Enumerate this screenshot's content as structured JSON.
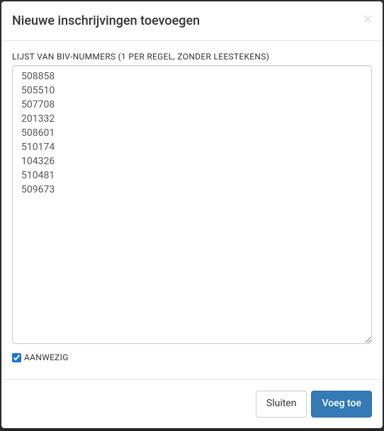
{
  "modal": {
    "title": "Nieuwe inschrijvingen toevoegen",
    "close_symbol": "×"
  },
  "form": {
    "list_label": "LIJST VAN BIV-NUMMERS (1 PER REGEL, ZONDER LEESTEKENS)",
    "list_value": "508858\n505510\n507708\n201332\n508601\n510174\n104326\n510481\n509673",
    "checkbox_label": "AANWEZIG",
    "checkbox_checked": true
  },
  "footer": {
    "cancel_label": "Sluiten",
    "submit_label": "Voeg toe"
  }
}
